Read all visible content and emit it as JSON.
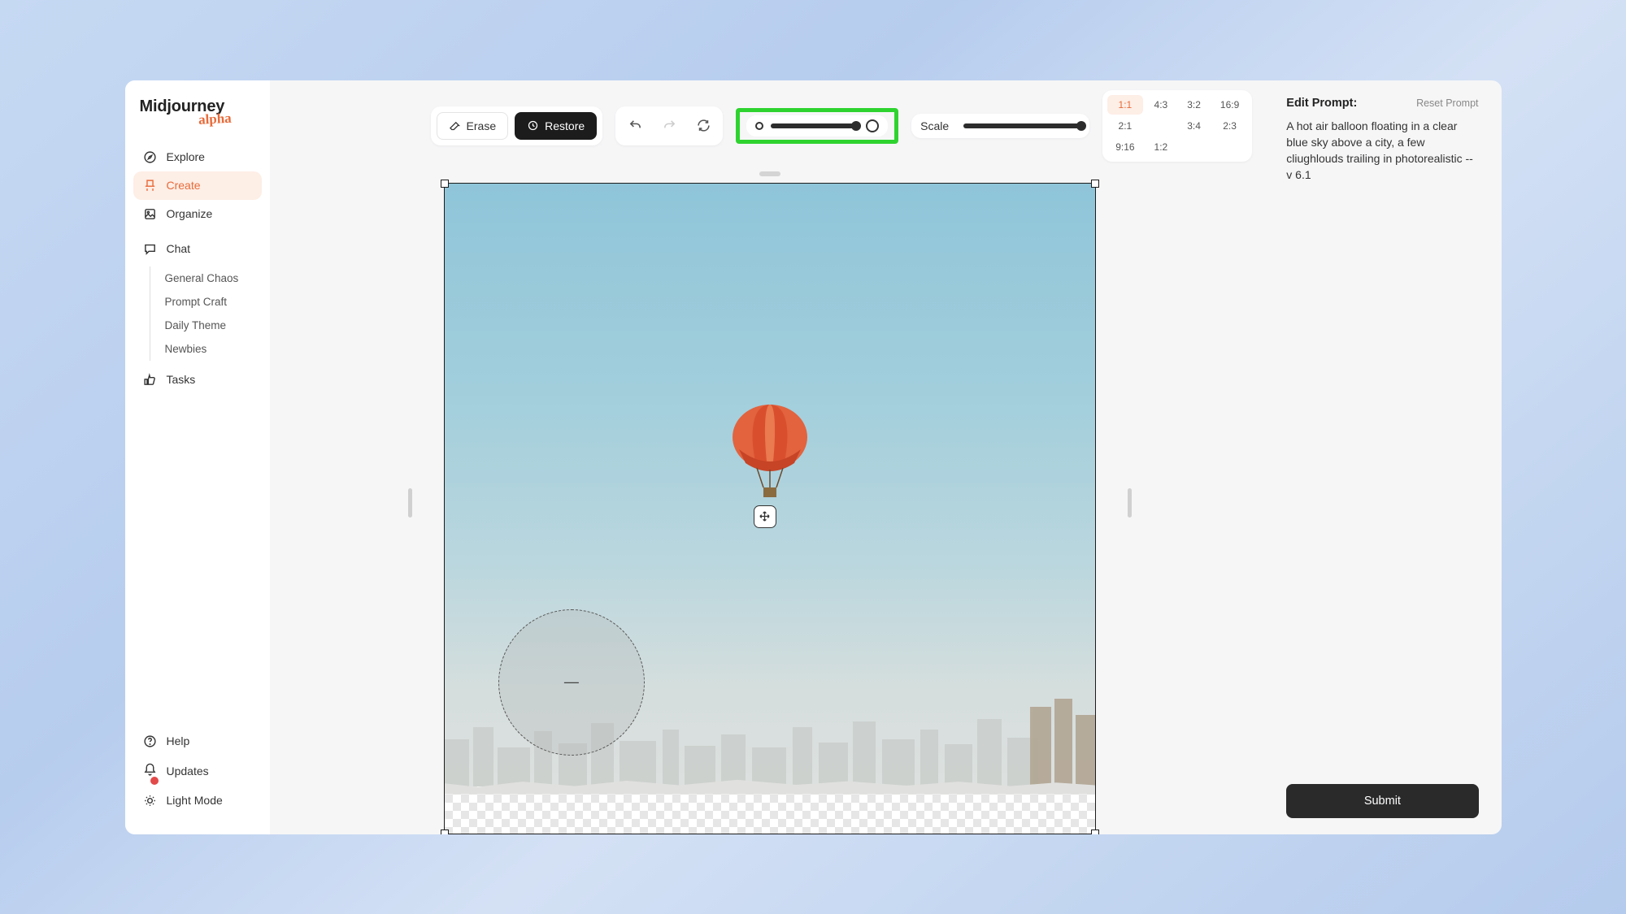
{
  "logo": {
    "main": "Midjourney",
    "sub": "alpha"
  },
  "nav": {
    "explore": "Explore",
    "create": "Create",
    "organize": "Organize",
    "chat": "Chat",
    "chat_rooms": [
      "General Chaos",
      "Prompt Craft",
      "Daily Theme",
      "Newbies"
    ],
    "tasks": "Tasks"
  },
  "footer_nav": {
    "help": "Help",
    "updates": "Updates",
    "light_mode": "Light Mode"
  },
  "toolbar": {
    "erase": "Erase",
    "restore": "Restore",
    "scale_label": "Scale"
  },
  "ratios": {
    "row1": [
      "1:1",
      "4:3",
      "3:2",
      "16:9",
      "2:1"
    ],
    "row2": [
      "3:4",
      "2:3",
      "9:16",
      "1:2"
    ],
    "active": "1:1"
  },
  "right_panel": {
    "title": "Edit Prompt:",
    "reset": "Reset Prompt",
    "prompt": "A hot air balloon floating in a clear blue sky above a city, a few cliughlouds trailing in photorealistic --v 6.1",
    "submit": "Submit"
  }
}
